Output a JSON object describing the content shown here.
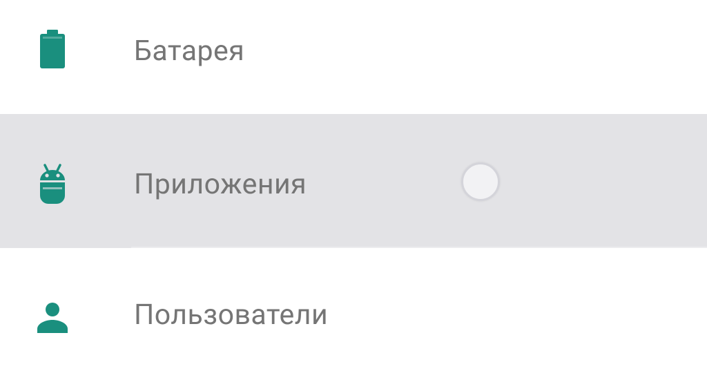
{
  "accent_color": "#1a8f7e",
  "settings": {
    "items": [
      {
        "label": "Батарея",
        "icon": "battery-icon"
      },
      {
        "label": "Приложения",
        "icon": "android-icon"
      },
      {
        "label": "Пользователи",
        "icon": "user-icon"
      }
    ]
  }
}
